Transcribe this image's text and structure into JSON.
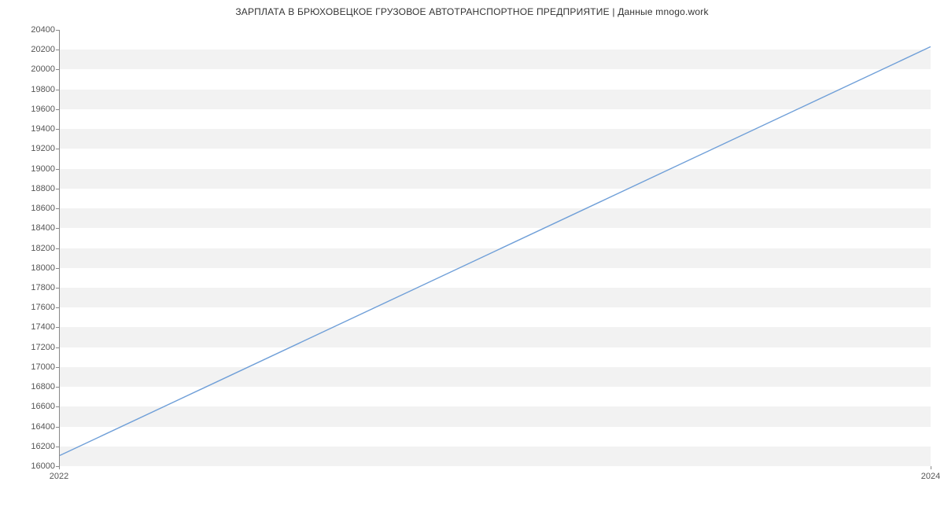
{
  "chart_data": {
    "type": "line",
    "title": "ЗАРПЛАТА В  БРЮХОВЕЦКОЕ ГРУЗОВОЕ АВТОТРАНСПОРТНОЕ ПРЕДПРИЯТИЕ | Данные mnogo.work",
    "x": [
      2022,
      2024
    ],
    "values": [
      16100,
      20230
    ],
    "xlabel": "",
    "ylabel": "",
    "xlim": [
      2022,
      2024
    ],
    "ylim": [
      16000,
      20400
    ],
    "y_ticks": [
      16000,
      16200,
      16400,
      16600,
      16800,
      17000,
      17200,
      17400,
      17600,
      17800,
      18000,
      18200,
      18400,
      18600,
      18800,
      19000,
      19200,
      19400,
      19600,
      19800,
      20000,
      20200,
      20400
    ],
    "x_ticks": [
      2022,
      2024
    ],
    "line_color": "#6f9fd8",
    "grid_band_color": "#f2f2f2"
  }
}
